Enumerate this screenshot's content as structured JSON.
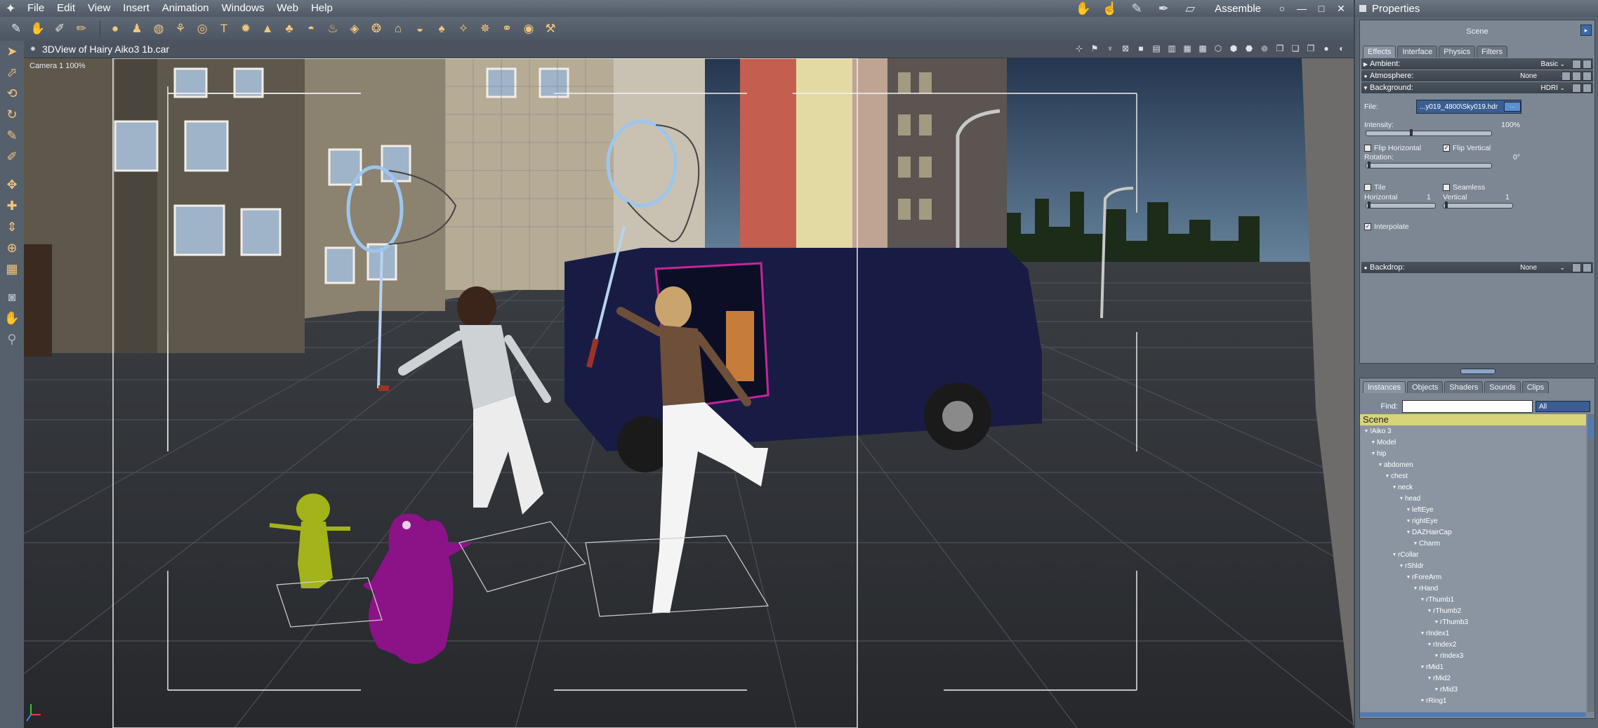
{
  "app": {
    "menus": [
      "File",
      "Edit",
      "View",
      "Insert",
      "Animation",
      "Windows",
      "Web",
      "Help"
    ],
    "room": "Assemble",
    "window_controls": [
      "○",
      "—",
      "□",
      "✕"
    ]
  },
  "viewport": {
    "title": "3DView of Hairy Aiko3 1b.car",
    "camera_label": "Camera 1 100%"
  },
  "properties": {
    "title": "Properties",
    "scene_label": "Scene",
    "tabs": [
      "Effects",
      "Interface",
      "Physics",
      "Filters"
    ],
    "ambient": {
      "label": "Ambient:",
      "value": "Basic"
    },
    "atmosphere": {
      "label": "Atmosphere:",
      "value": "None"
    },
    "background": {
      "label": "Background:",
      "value": "HDRI",
      "file_label": "File:",
      "file_value": "...y019_4800\\Sky019.hdr",
      "intensity_label": "Intensity:",
      "intensity_value": "100%",
      "intensity_level": 0.35,
      "flip_horizontal": "Flip Horizontal",
      "flip_vertical": "Flip Vertical",
      "rotation_label": "Rotation:",
      "rotation_value": "0°",
      "tile": "Tile",
      "seamless": "Seamless",
      "horizontal_label": "Horizontal",
      "horizontal_value": "1",
      "vertical_label": "Vertical",
      "vertical_value": "1",
      "interpolate": "Interpolate"
    },
    "backdrop": {
      "label": "Backdrop:",
      "value": "None"
    }
  },
  "instances": {
    "tabs": [
      "Instances",
      "Objects",
      "Shaders",
      "Sounds",
      "Clips"
    ],
    "find_label": "Find:",
    "find_value": "",
    "filter_value": "All",
    "tree_header": "Scene",
    "tree": [
      {
        "label": "!Aiko 3",
        "depth": 0
      },
      {
        "label": "Model",
        "depth": 1
      },
      {
        "label": "hip",
        "depth": 1
      },
      {
        "label": "abdomen",
        "depth": 2
      },
      {
        "label": "chest",
        "depth": 3
      },
      {
        "label": "neck",
        "depth": 4
      },
      {
        "label": "head",
        "depth": 5
      },
      {
        "label": "leftEye",
        "depth": 6
      },
      {
        "label": "rightEye",
        "depth": 6
      },
      {
        "label": "DAZHairCap",
        "depth": 6
      },
      {
        "label": "Charm",
        "depth": 7
      },
      {
        "label": "rCollar",
        "depth": 4
      },
      {
        "label": "rShldr",
        "depth": 5
      },
      {
        "label": "rForeArm",
        "depth": 6
      },
      {
        "label": "rHand",
        "depth": 7
      },
      {
        "label": "rThumb1",
        "depth": 8
      },
      {
        "label": "rThumb2",
        "depth": 9
      },
      {
        "label": "rThumb3",
        "depth": 10
      },
      {
        "label": "rIndex1",
        "depth": 8
      },
      {
        "label": "rIndex2",
        "depth": 9
      },
      {
        "label": "rIndex3",
        "depth": 10
      },
      {
        "label": "rMid1",
        "depth": 8
      },
      {
        "label": "rMid2",
        "depth": 9
      },
      {
        "label": "rMid3",
        "depth": 10
      },
      {
        "label": "rRing1",
        "depth": 8
      }
    ]
  }
}
